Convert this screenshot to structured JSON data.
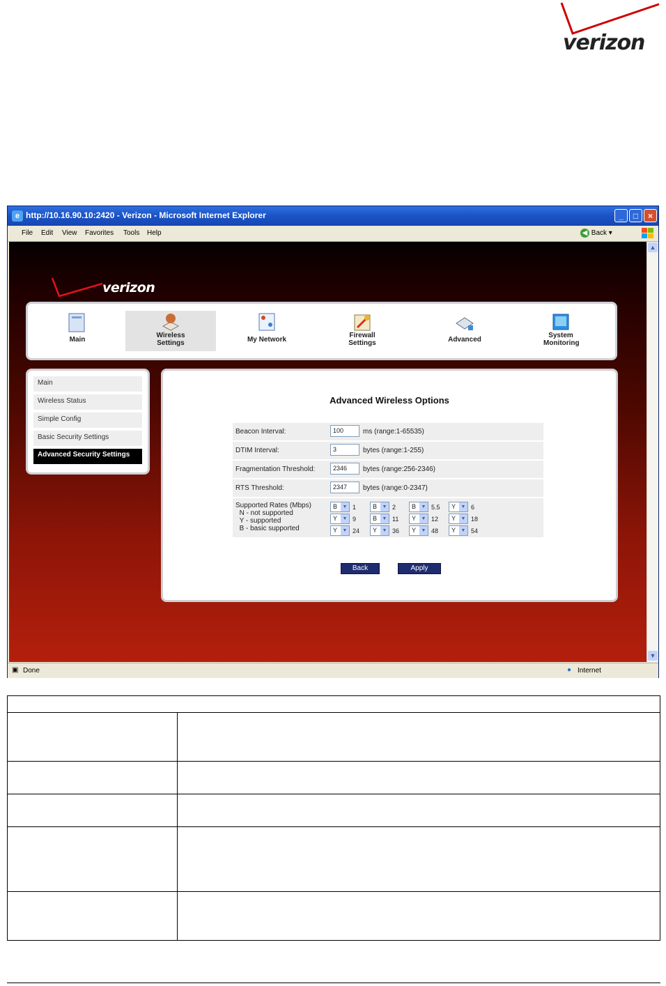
{
  "doc": {
    "logo_text": "verizon"
  },
  "window": {
    "title": "http://10.16.90.10:2420 - Verizon - Microsoft Internet Explorer",
    "menus": [
      "File",
      "Edit",
      "View",
      "Favorites",
      "Tools",
      "Help"
    ],
    "back_label": "Back",
    "status_left": "Done",
    "status_right": "Internet"
  },
  "app": {
    "logo_text": "verizon",
    "nav": [
      {
        "label": "Main",
        "icon": "main-icon"
      },
      {
        "label": "Wireless Settings",
        "icon": "wireless-icon"
      },
      {
        "label": "My Network",
        "icon": "network-icon"
      },
      {
        "label": "Firewall Settings",
        "icon": "firewall-icon"
      },
      {
        "label": "Advanced",
        "icon": "advanced-icon"
      },
      {
        "label": "System Monitoring",
        "icon": "monitor-icon"
      }
    ],
    "left_menu": [
      "Main",
      "Wireless Status",
      "Simple Config",
      "Basic Security Settings",
      "Advanced Security Settings"
    ],
    "panel_title": "Advanced Wireless Options",
    "beacon": {
      "label": "Beacon Interval:",
      "value": "100",
      "note": "ms (range:1-65535)"
    },
    "dtim": {
      "label": "DTIM Interval:",
      "value": "3",
      "note": "bytes (range:1-255)"
    },
    "frag": {
      "label": "Fragmentation Threshold:",
      "value": "2346",
      "note": "bytes (range:256-2346)"
    },
    "rts": {
      "label": "RTS Threshold:",
      "value": "2347",
      "note": "bytes (range:0-2347)"
    },
    "rates": {
      "label1": "Supported Rates (Mbps)",
      "label2": "N - not supported",
      "label3": "Y - supported",
      "label4": "B - basic supported",
      "items": [
        {
          "sel": "B",
          "rate": "1"
        },
        {
          "sel": "B",
          "rate": "2"
        },
        {
          "sel": "B",
          "rate": "5.5"
        },
        {
          "sel": "Y",
          "rate": "6"
        },
        {
          "sel": "Y",
          "rate": "9"
        },
        {
          "sel": "B",
          "rate": "11"
        },
        {
          "sel": "Y",
          "rate": "12"
        },
        {
          "sel": "Y",
          "rate": "18"
        },
        {
          "sel": "Y",
          "rate": "24"
        },
        {
          "sel": "Y",
          "rate": "36"
        },
        {
          "sel": "Y",
          "rate": "48"
        },
        {
          "sel": "Y",
          "rate": "54"
        }
      ]
    },
    "back_button": "Back",
    "apply_button": "Apply"
  }
}
